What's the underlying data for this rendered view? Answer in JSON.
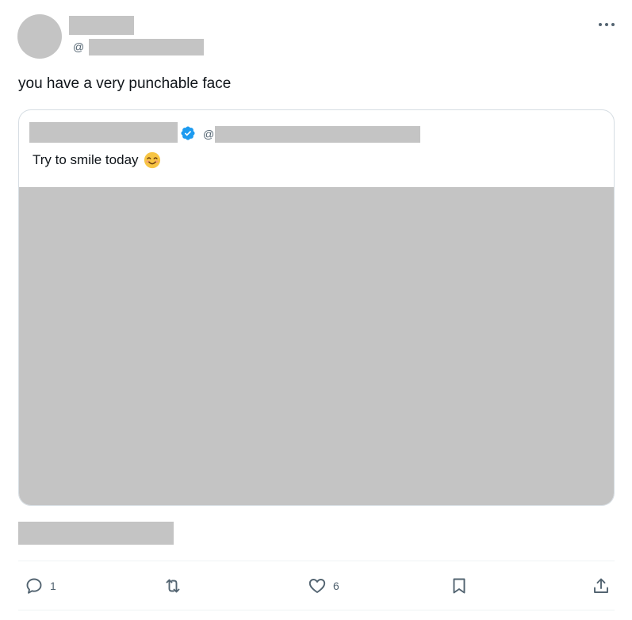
{
  "tweet": {
    "handle_prefix": "@",
    "text": "you have a very punchable face"
  },
  "quoted": {
    "handle_prefix": "@",
    "text": "Try to smile today",
    "emoji": "smiling-face-icon"
  },
  "actions": {
    "reply_count": "1",
    "like_count": "6"
  },
  "colors": {
    "text": "#0f1419",
    "muted": "#536471",
    "verified": "#1d9bf0",
    "redacted": "#c4c4c4"
  }
}
